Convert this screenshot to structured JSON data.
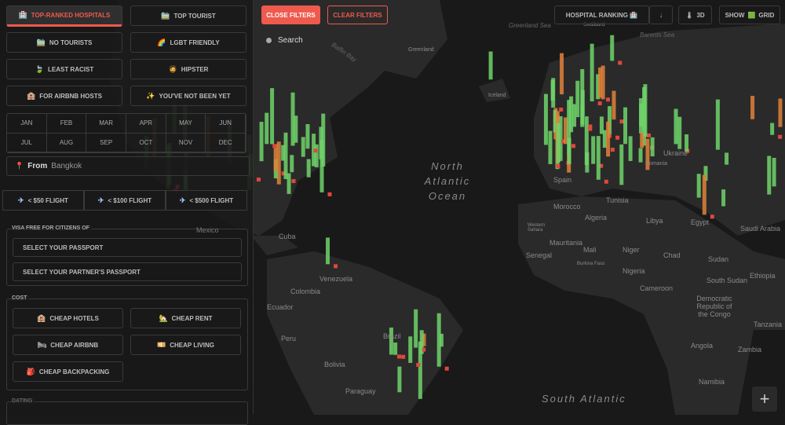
{
  "sidebar": {
    "categories": [
      {
        "label": "TOP-RANKED HOSPITALS",
        "icon": "🏥",
        "active": true
      },
      {
        "label": "TOP TOURIST",
        "icon": "🚞"
      },
      {
        "label": "NO TOURISTS",
        "icon": "🚞"
      },
      {
        "label": "LGBT FRIENDLY",
        "icon": "🌈"
      },
      {
        "label": "LEAST RACIST",
        "icon": "🍃"
      },
      {
        "label": "HIPSTER",
        "icon": "🧔"
      },
      {
        "label": "FOR AIRBNB HOSTS",
        "icon": "🏨"
      },
      {
        "label": "YOU'VE NOT BEEN YET",
        "icon": "✨"
      }
    ],
    "months": [
      "JAN",
      "FEB",
      "MAR",
      "APR",
      "MAY",
      "JUN",
      "JUL",
      "AUG",
      "SEP",
      "OCT",
      "NOV",
      "DEC"
    ],
    "from": {
      "icon": "📍",
      "label": "From",
      "value": "Bangkok"
    },
    "flights": [
      {
        "label": "< $50 FLIGHT",
        "icon": "✈"
      },
      {
        "label": "< $100 FLIGHT",
        "icon": "✈"
      },
      {
        "label": "< $500 FLIGHT",
        "icon": "✈"
      }
    ],
    "visa": {
      "legend": "VISA FREE FOR CITIZENS OF",
      "passport": "SELECT YOUR PASSPORT",
      "partner": "SELECT YOUR PARTNER'S PASSPORT"
    },
    "cost": {
      "legend": "COST",
      "items": [
        {
          "label": "CHEAP HOTELS",
          "icon": "🏨"
        },
        {
          "label": "CHEAP RENT",
          "icon": "🏡"
        },
        {
          "label": "CHEAP AIRBNB",
          "icon": "🛏"
        },
        {
          "label": "CHEAP LIVING",
          "icon": "💴"
        },
        {
          "label": "CHEAP BACKPACKING",
          "icon": "🎒"
        }
      ]
    },
    "dating": {
      "legend": "DATING"
    }
  },
  "toolbar": {
    "close_filters": "CLOSE FILTERS",
    "clear_filters": "CLEAR FILTERS",
    "search_placeholder": "Search",
    "ranking": "HOSPITAL RANKING 🏥",
    "sort": "↓",
    "view3d": "3D",
    "view3d_icon": "🌡",
    "grid_show": "SHOW",
    "grid_icon": "🟩",
    "grid_label": "GRID",
    "zoom_in": "+"
  },
  "colors": {
    "accent": "#ef5a4e",
    "bar_high": "#6fd36a",
    "bar_low": "#e0813a",
    "dot": "#e0483c"
  },
  "map": {
    "labels": {
      "greenland_sea": "Greenland Sea",
      "svalbard": "Svalbard",
      "barents": "Barents Sea",
      "greenland": "Greenland",
      "baffin": "Baffin Bay",
      "iceland": "Iceland",
      "north_atlantic": "North Atlantic Ocean",
      "south_atlantic": "South Atlantic",
      "ukraine": "Ukraine",
      "romania": "Romania",
      "spain": "Spain",
      "tunisia": "Tunisia",
      "morocco": "Morocco",
      "algeria": "Algeria",
      "libya": "Libya",
      "egypt": "Egypt",
      "saudi": "Saudi Arabia",
      "western_sahara": "Western Sahara",
      "mauritania": "Mauritania",
      "mali": "Mali",
      "niger": "Niger",
      "chad": "Chad",
      "sudan": "Sudan",
      "senegal": "Senegal",
      "burkina": "Burkina Faso",
      "nigeria": "Nigeria",
      "cameroon": "Cameroon",
      "south_sudan": "South Sudan",
      "ethiopia": "Ethiopia",
      "drc": "Democratic Republic of the Congo",
      "tanzania": "Tanzania",
      "angola": "Angola",
      "zambia": "Zambia",
      "namibia": "Namibia",
      "cuba": "Cuba",
      "mexico": "Mexico",
      "venezuela": "Venezuela",
      "colombia": "Colombia",
      "ecuador": "Ecuador",
      "peru": "Peru",
      "brazil": "Brazil",
      "bolivia": "Bolivia",
      "paraguay": "Paraguay"
    }
  }
}
